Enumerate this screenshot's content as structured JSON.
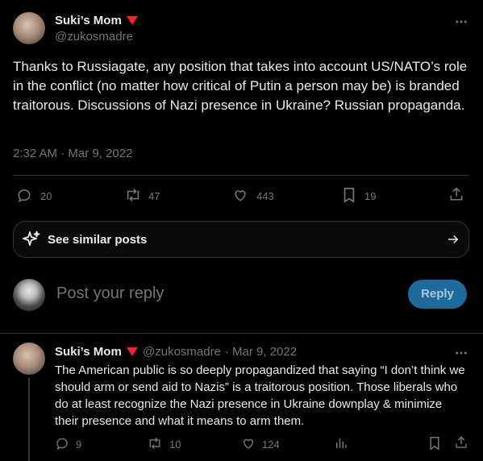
{
  "main_post": {
    "display_name": "Suki’s Mom",
    "handle": "@zukosmadre",
    "text": "Thanks to Russiagate, any position that takes into account US/NATO’s role in the conflict (no matter how critical of Putin a person may be) is branded traitorous. Discussions of Nazi presence in Ukraine? Russian propaganda.",
    "timestamp": "2:32 AM · Mar 9, 2022",
    "stats": {
      "replies": "20",
      "reposts": "47",
      "likes": "443",
      "bookmarks": "19"
    },
    "icons": [
      "more-icon",
      "reply-icon",
      "repost-icon",
      "like-icon",
      "bookmark-icon",
      "share-icon"
    ]
  },
  "similar_posts": {
    "label": "See similar posts",
    "icon": "sparkle-icon",
    "arrow": "arrow-right-icon"
  },
  "composer": {
    "placeholder": "Post your reply",
    "button_label": "Reply"
  },
  "reply_post": {
    "display_name": "Suki’s Mom",
    "handle": "@zukosmadre",
    "date": "Mar 9, 2022",
    "text": "The American public is so deeply propagandized that saying “I don’t think we should arm or send aid to Nazis” is a traitorous position. Those liberals who do at least recognize the Nazi presence in Ukraine downplay & minimize their presence and what it means to arm them.",
    "stats": {
      "replies": "9",
      "reposts": "10",
      "likes": "124"
    },
    "icons": [
      "more-icon",
      "reply-icon",
      "repost-icon",
      "like-icon",
      "views-icon",
      "bookmark-icon",
      "share-icon"
    ]
  },
  "colors": {
    "background": "#000000",
    "text": "#e7e9ea",
    "muted": "#71767b",
    "badge": "#f4212e",
    "accent_button": "#1d6a9c"
  }
}
